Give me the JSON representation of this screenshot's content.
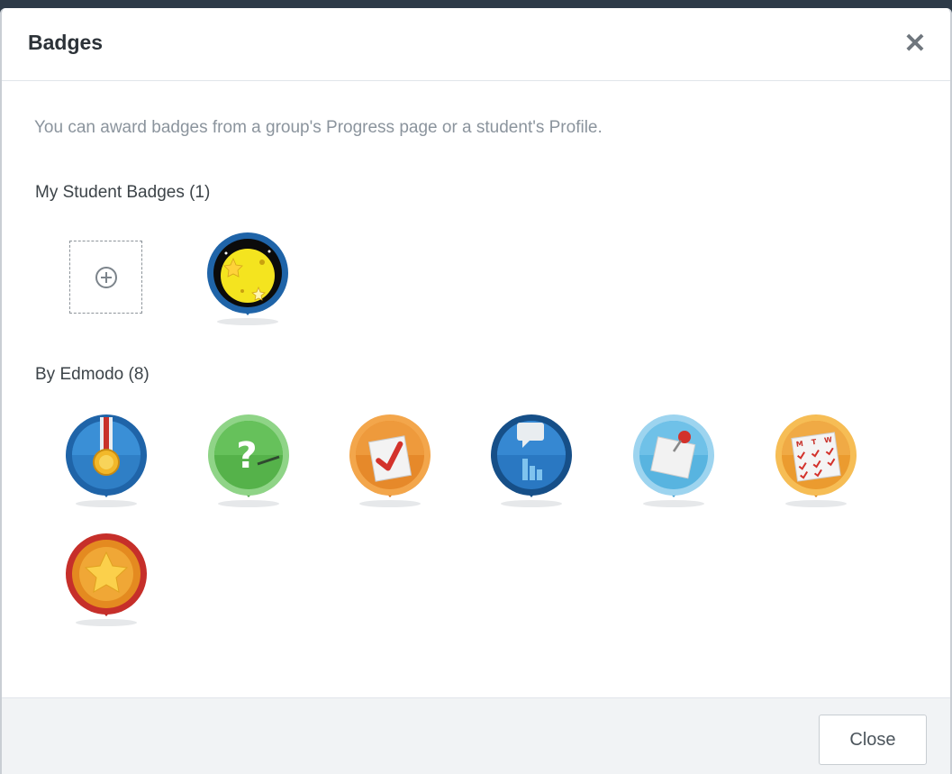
{
  "modal": {
    "title": "Badges",
    "close_glyph": "✕",
    "info": "You can award badges from a group's Progress page or a student's Profile.",
    "footer_close_label": "Close"
  },
  "sections": {
    "my_badges_label": "My Student Badges (1)",
    "edmodo_label": "By Edmodo (8)"
  },
  "icons": {
    "close": "close-icon",
    "add": "plus-circle-icon",
    "custom_badge": "stars-moon-badge-icon",
    "edmodo_badges": [
      "medal-badge-icon",
      "question-badge-icon",
      "checklist-badge-icon",
      "speech-chart-badge-icon",
      "pinned-note-badge-icon",
      "calendar-badge-icon",
      "star-badge-icon"
    ]
  },
  "colors": {
    "blue_ring": "#1f64a8",
    "green_ring": "#55b24a",
    "orange_ring": "#e6892a",
    "lightblue_ring": "#58b4e0",
    "red_ring": "#c62f2a"
  },
  "calendar_days": [
    "M",
    "T",
    "W"
  ]
}
